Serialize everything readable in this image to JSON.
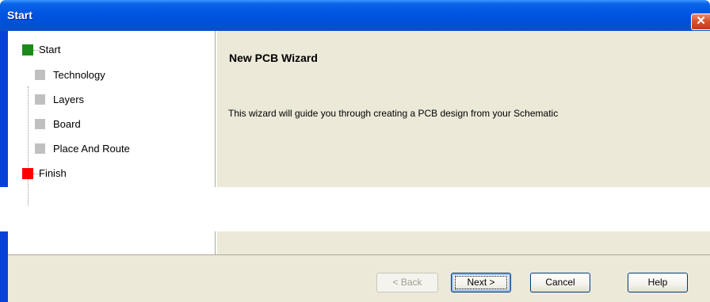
{
  "window": {
    "title": "Start",
    "close_icon": "✕"
  },
  "steps": [
    {
      "label": "Start",
      "level": 0,
      "state": "current",
      "color": "#1a8a1a"
    },
    {
      "label": "Technology",
      "level": 1,
      "state": "pending",
      "color": "#c0c0c0"
    },
    {
      "label": "Layers",
      "level": 1,
      "state": "pending",
      "color": "#c0c0c0"
    },
    {
      "label": "Board",
      "level": 1,
      "state": "pending",
      "color": "#c0c0c0"
    },
    {
      "label": "Place And Route",
      "level": 1,
      "state": "pending",
      "color": "#c0c0c0"
    },
    {
      "label": "Finish",
      "level": 0,
      "state": "end",
      "color": "#ff0000"
    }
  ],
  "content": {
    "title": "New PCB Wizard",
    "description": "This wizard will guide you through creating a PCB design from your Schematic"
  },
  "buttons": {
    "back": "< Back",
    "next": "Next >",
    "cancel": "Cancel",
    "help": "Help"
  }
}
